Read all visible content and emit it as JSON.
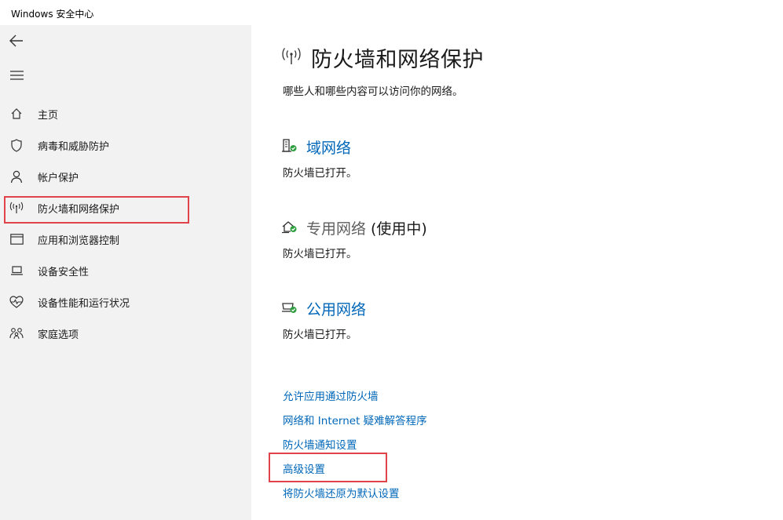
{
  "window": {
    "title": "Windows 安全中心"
  },
  "sidebar": {
    "items": [
      {
        "label": "主页",
        "icon": "home-icon"
      },
      {
        "label": "病毒和威胁防护",
        "icon": "shield-icon"
      },
      {
        "label": "帐户保护",
        "icon": "person-icon"
      },
      {
        "label": "防火墙和网络保护",
        "icon": "wifi-antenna-icon",
        "selected": true
      },
      {
        "label": "应用和浏览器控制",
        "icon": "browser-window-icon"
      },
      {
        "label": "设备安全性",
        "icon": "laptop-icon"
      },
      {
        "label": "设备性能和运行状况",
        "icon": "heart-pulse-icon"
      },
      {
        "label": "家庭选项",
        "icon": "family-icon"
      }
    ]
  },
  "main": {
    "title": "防火墙和网络保护",
    "description": "哪些人和哪些内容可以访问你的网络。",
    "networks": [
      {
        "name": "域网络",
        "status": "防火墙已打开。",
        "suffix": ""
      },
      {
        "name": "专用网络",
        "status": "防火墙已打开。",
        "suffix": "(使用中)"
      },
      {
        "name": "公用网络",
        "status": "防火墙已打开。",
        "suffix": ""
      }
    ],
    "links": [
      "允许应用通过防火墙",
      "网络和 Internet 疑难解答程序",
      "防火墙通知设置",
      "高级设置",
      "将防火墙还原为默认设置"
    ]
  },
  "colors": {
    "accent": "#0067b8",
    "highlight": "#e0434a",
    "ok": "#2e9e3e",
    "sidebar_bg": "#f2f2f2"
  }
}
